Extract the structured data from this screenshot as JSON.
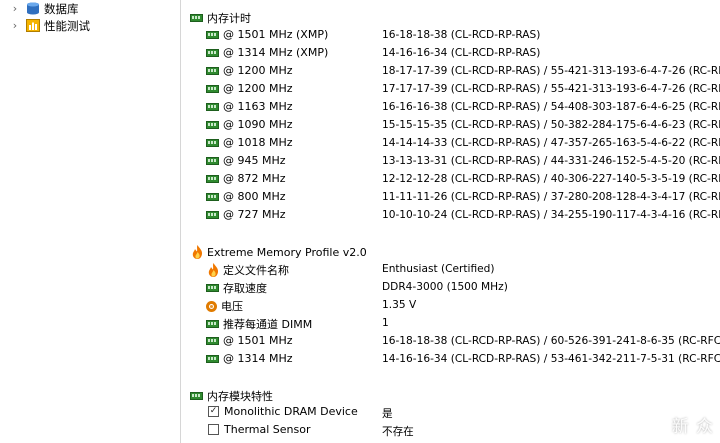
{
  "tree": [
    {
      "label": "数据库",
      "icon": "database-icon"
    },
    {
      "label": "性能测试",
      "icon": "benchmark-icon"
    }
  ],
  "timings_section": {
    "title": "内存计时",
    "rows": [
      {
        "label": "@ 1501 MHz (XMP)",
        "value": "16-18-18-38  (CL-RCD-RP-RAS)"
      },
      {
        "label": "@ 1314 MHz (XMP)",
        "value": "14-16-16-34  (CL-RCD-RP-RAS)"
      },
      {
        "label": "@ 1200 MHz",
        "value": "18-17-17-39  (CL-RCD-RP-RAS) / 55-421-313-193-6-4-7-26  (RC-RF..."
      },
      {
        "label": "@ 1200 MHz",
        "value": "17-17-17-39  (CL-RCD-RP-RAS) / 55-421-313-193-6-4-7-26  (RC-RF..."
      },
      {
        "label": "@ 1163 MHz",
        "value": "16-16-16-38  (CL-RCD-RP-RAS) / 54-408-303-187-6-4-6-25  (RC-RF..."
      },
      {
        "label": "@ 1090 MHz",
        "value": "15-15-15-35  (CL-RCD-RP-RAS) / 50-382-284-175-6-4-6-23  (RC-RF..."
      },
      {
        "label": "@ 1018 MHz",
        "value": "14-14-14-33  (CL-RCD-RP-RAS) / 47-357-265-163-5-4-6-22  (RC-RF..."
      },
      {
        "label": "@ 945 MHz",
        "value": "13-13-13-31  (CL-RCD-RP-RAS) / 44-331-246-152-5-4-5-20  (RC-RF..."
      },
      {
        "label": "@ 872 MHz",
        "value": "12-12-12-28  (CL-RCD-RP-RAS) / 40-306-227-140-5-3-5-19  (RC-RF..."
      },
      {
        "label": "@ 800 MHz",
        "value": "11-11-11-26  (CL-RCD-RP-RAS) / 37-280-208-128-4-3-4-17  (RC-RF..."
      },
      {
        "label": "@ 727 MHz",
        "value": "10-10-10-24  (CL-RCD-RP-RAS) / 34-255-190-117-4-3-4-16  (RC-RF..."
      }
    ]
  },
  "xmp_section": {
    "title": "Extreme Memory Profile v2.0",
    "rows": [
      {
        "label": "定义文件名称",
        "value": "Enthusiast (Certified)",
        "icon": "flame-icon"
      },
      {
        "label": "存取速度",
        "value": "DDR4-3000 (1500 MHz)",
        "icon": "ram-icon"
      },
      {
        "label": "电压",
        "value": "1.35 V",
        "icon": "voltage-icon"
      },
      {
        "label": "推荐每通道 DIMM",
        "value": "1",
        "icon": "ram-icon"
      },
      {
        "label": "@ 1501 MHz",
        "value": "16-18-18-38  (CL-RCD-RP-RAS) / 60-526-391-241-8-6-35  (RC-RFC...",
        "icon": "ram-icon"
      },
      {
        "label": "@ 1314 MHz",
        "value": "14-16-16-34  (CL-RCD-RP-RAS) / 53-461-342-211-7-5-31  (RC-RFC...",
        "icon": "ram-icon"
      }
    ]
  },
  "features_section": {
    "title": "内存模块特性",
    "rows": [
      {
        "label": "Monolithic DRAM Device",
        "value": "是",
        "checked": true
      },
      {
        "label": "Thermal Sensor",
        "value": "不存在",
        "checked": false
      }
    ]
  },
  "watermark": "新 众",
  "colors": {
    "ram": "#2f8a2f",
    "flame": "#f07800",
    "voltage": "#e07b00"
  }
}
